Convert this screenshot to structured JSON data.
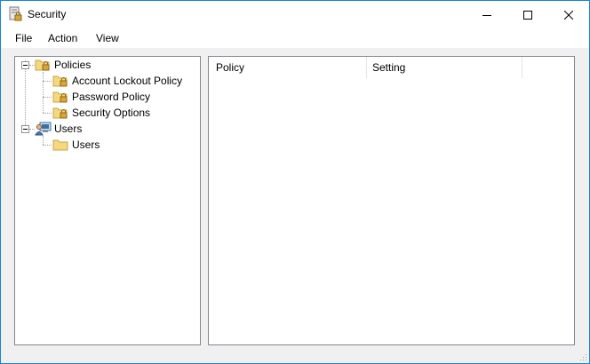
{
  "window": {
    "title": "Security",
    "app_icon": "security-policy-icon"
  },
  "caption_buttons": {
    "minimize": "minimize-icon",
    "maximize": "maximize-icon",
    "close": "close-icon"
  },
  "menu": {
    "items": [
      "File",
      "Action",
      "View"
    ]
  },
  "tree": {
    "policies": {
      "label": "Policies",
      "icon": "folder-lock-icon",
      "expanded": true,
      "children": [
        {
          "label": "Account Lockout Policy",
          "icon": "folder-lock-icon"
        },
        {
          "label": "Password Policy",
          "icon": "folder-lock-icon"
        },
        {
          "label": "Security Options",
          "icon": "folder-lock-icon"
        }
      ]
    },
    "users": {
      "label": "Users",
      "icon": "users-computer-icon",
      "expanded": true,
      "children": [
        {
          "label": "Users",
          "icon": "folder-icon"
        }
      ]
    }
  },
  "list": {
    "columns": [
      "Policy",
      "Setting"
    ],
    "rows": []
  },
  "colors": {
    "window_border": "#1883d7",
    "folder": "#f5d77f",
    "lock": "#d9a53a"
  }
}
